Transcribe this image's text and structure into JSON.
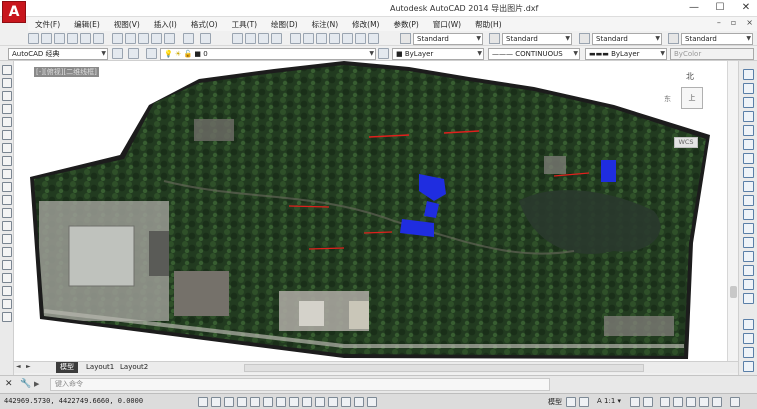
{
  "window": {
    "logo_letter": "A",
    "title": "Autodesk AutoCAD 2014     导出图片.dxf",
    "minimize": "—",
    "restore": "☐",
    "close": "✕"
  },
  "menu": {
    "items": [
      "文件(F)",
      "编辑(E)",
      "视图(V)",
      "插入(I)",
      "格式(O)",
      "工具(T)",
      "绘图(D)",
      "标注(N)",
      "修改(M)",
      "参数(P)",
      "窗口(W)",
      "帮助(H)"
    ],
    "doc_controls": [
      "–",
      "▫",
      "×"
    ]
  },
  "toolbar_top": {
    "text_style": "Standard",
    "dim_style": "Standard",
    "table_style": "Standard",
    "multileader_style": "Standard"
  },
  "toolbar_second": {
    "workspace": "AutoCAD 经典",
    "layer": "0",
    "color": "ByLayer",
    "linetype": "CONTINUOUS",
    "lineweight": "ByLayer",
    "plot_style": "ByColor"
  },
  "drawing": {
    "viewport_label": "[-][俯视][二维线框]",
    "compass_north": "北",
    "compass_east": "东",
    "viewcube_face": "上",
    "ucs_label": "WCS",
    "map_colors": {
      "dark_green": "#213a1f",
      "mid_green": "#2f4f2b",
      "building_gray": "#8e8f8a",
      "highlight_blue": "#1f2de0",
      "annotation_red": "#e0201d"
    }
  },
  "layout_tabs": {
    "nav": [
      "◄",
      "►"
    ],
    "tabs": [
      "模型",
      "Layout1",
      "Layout2"
    ],
    "active": "模型"
  },
  "command_line": {
    "close_icon": "✕",
    "settings_icon": "🔧",
    "prompt_icon": "▶",
    "placeholder": "键入命令"
  },
  "status": {
    "coordinates": "442969.5730, 4422749.6660, 0.0000",
    "model_label": "模型",
    "annotation_scale": "A 1:1 ▾"
  }
}
